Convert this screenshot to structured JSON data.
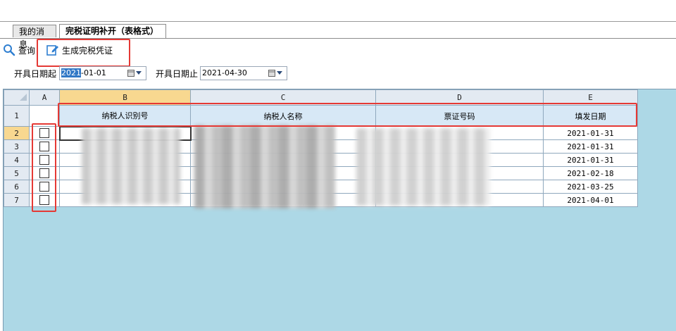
{
  "tabs": [
    {
      "label": "我的消息"
    },
    {
      "label": "完税证明补开（表格式）"
    }
  ],
  "toolbar": {
    "query_label": "查询",
    "generate_label": "生成完税凭证"
  },
  "filters": {
    "start_label": "开具日期起",
    "start_value_sel": "2021",
    "start_value_rest": "-01-01",
    "end_label": "开具日期止",
    "end_value": "2021-04-30"
  },
  "sheet": {
    "columns": [
      "A",
      "B",
      "C",
      "D",
      "E"
    ],
    "header_row_number": "1",
    "headers": {
      "b": "纳税人识别号",
      "c": "纳税人名称",
      "d": "票证号码",
      "e": "填发日期"
    },
    "rows": [
      {
        "num": "2",
        "date": "2021-01-31"
      },
      {
        "num": "3",
        "date": "2021-01-31"
      },
      {
        "num": "4",
        "date": "2021-01-31"
      },
      {
        "num": "5",
        "date": "2021-02-18"
      },
      {
        "num": "6",
        "date": "2021-03-25"
      },
      {
        "num": "7",
        "date": "2021-04-01"
      }
    ]
  },
  "colors": {
    "highlight_box": "#e53935",
    "grid_background": "#add8e6",
    "header_fill": "#d7e8f6",
    "active_header": "#f8d890"
  }
}
